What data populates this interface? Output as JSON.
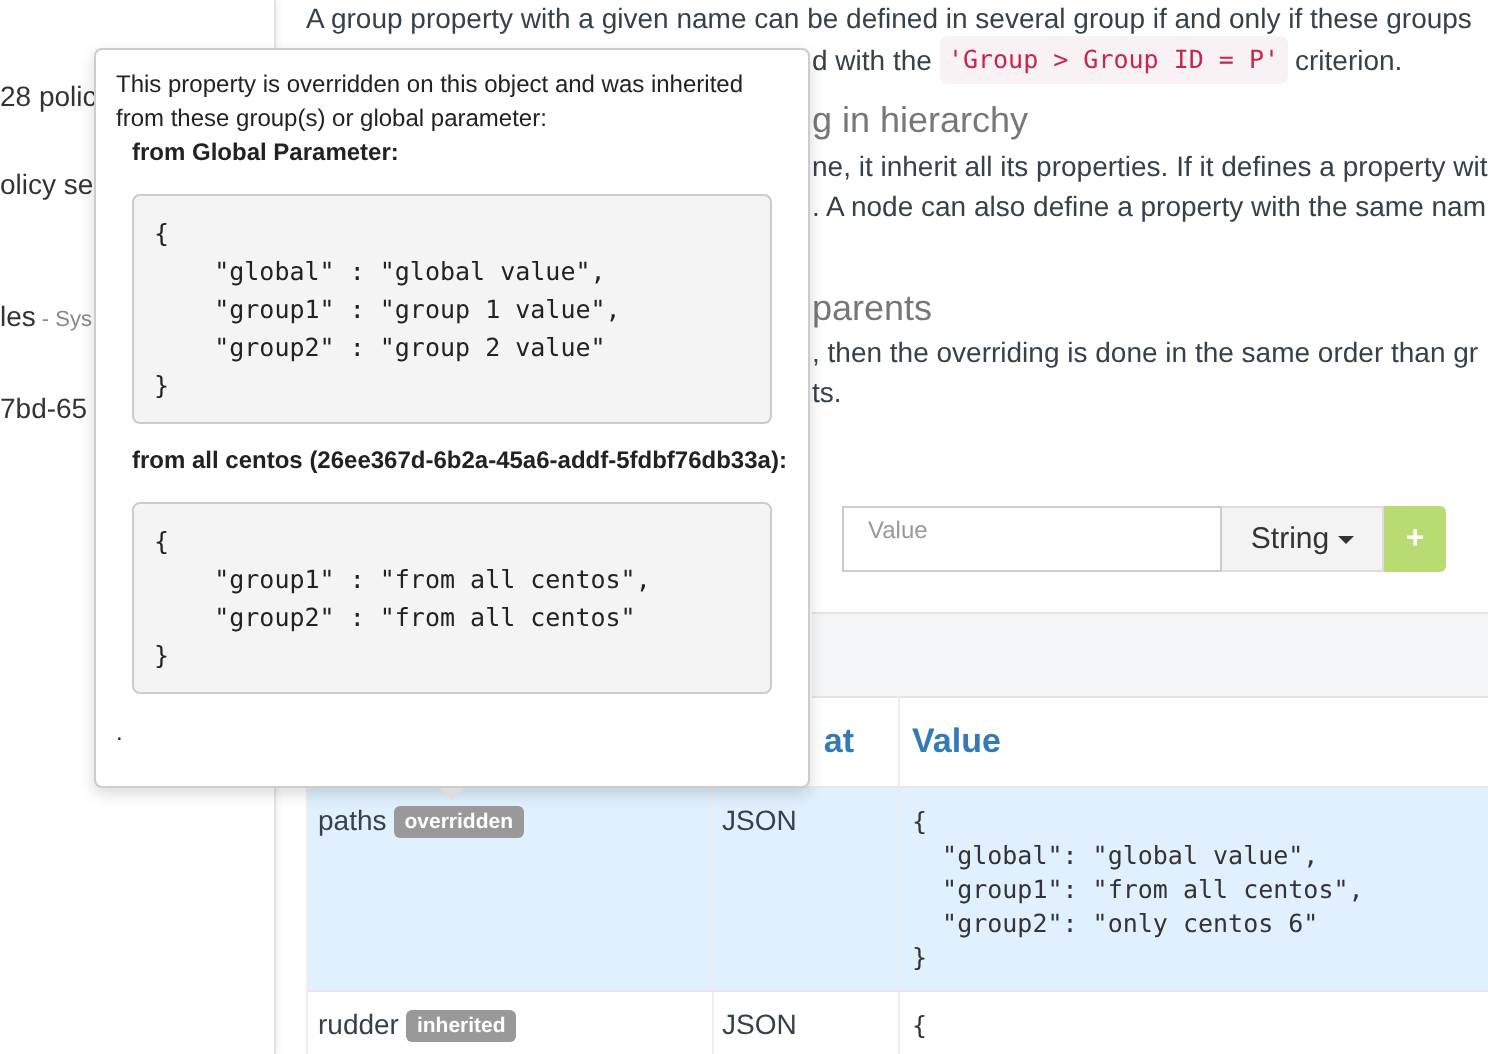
{
  "sidebar": {
    "items": [
      {
        "text": "28 polic"
      },
      {
        "text": "olicy se"
      },
      {
        "text": "les",
        "note": "- Sys"
      },
      {
        "text": "7bd-65"
      }
    ]
  },
  "content": {
    "intro_line": "A group property with a given name can be defined in several group if and only if these groups",
    "intro_fragment": {
      "before": "d with the",
      "code": "'Group > Group ID = P'",
      "after": "criterion."
    },
    "sections": [
      {
        "heading": "g in hierarchy",
        "lines": [
          "ne, it inherit all its properties. If it defines a property wit",
          ". A node can also define a property with the same nam"
        ]
      },
      {
        "heading": "parents",
        "lines": [
          ", then the overriding is done in the same order than gr",
          "ts."
        ]
      }
    ]
  },
  "form": {
    "value_placeholder": "Value",
    "type_button": "String",
    "add_button": "+"
  },
  "table": {
    "columns": [
      "at",
      "Value"
    ],
    "rows": [
      {
        "name": "paths",
        "badge": "overridden",
        "format": "JSON",
        "value": "{\n  \"global\": \"global value\",\n  \"group1\": \"from all centos\",\n  \"group2\": \"only centos 6\"\n}",
        "selected": true
      },
      {
        "name": "rudder",
        "badge": "inherited",
        "format": "JSON",
        "value": "{",
        "selected": false
      }
    ]
  },
  "popover": {
    "intro": "This property is overridden on this object and was inherited from these group(s) or global parameter:",
    "sources": [
      {
        "title": "from Global Parameter:",
        "code": "{\n    \"global\" : \"global value\",\n    \"group1\" : \"group 1 value\",\n    \"group2\" : \"group 2 value\"\n}"
      },
      {
        "title": "from all centos (26ee367d-6b2a-45a6-addf-5fdbf76db33a):",
        "code": "{\n    \"group1\" : \"from all centos\",\n    \"group2\" : \"from all centos\"\n}"
      }
    ],
    "footer": "."
  }
}
